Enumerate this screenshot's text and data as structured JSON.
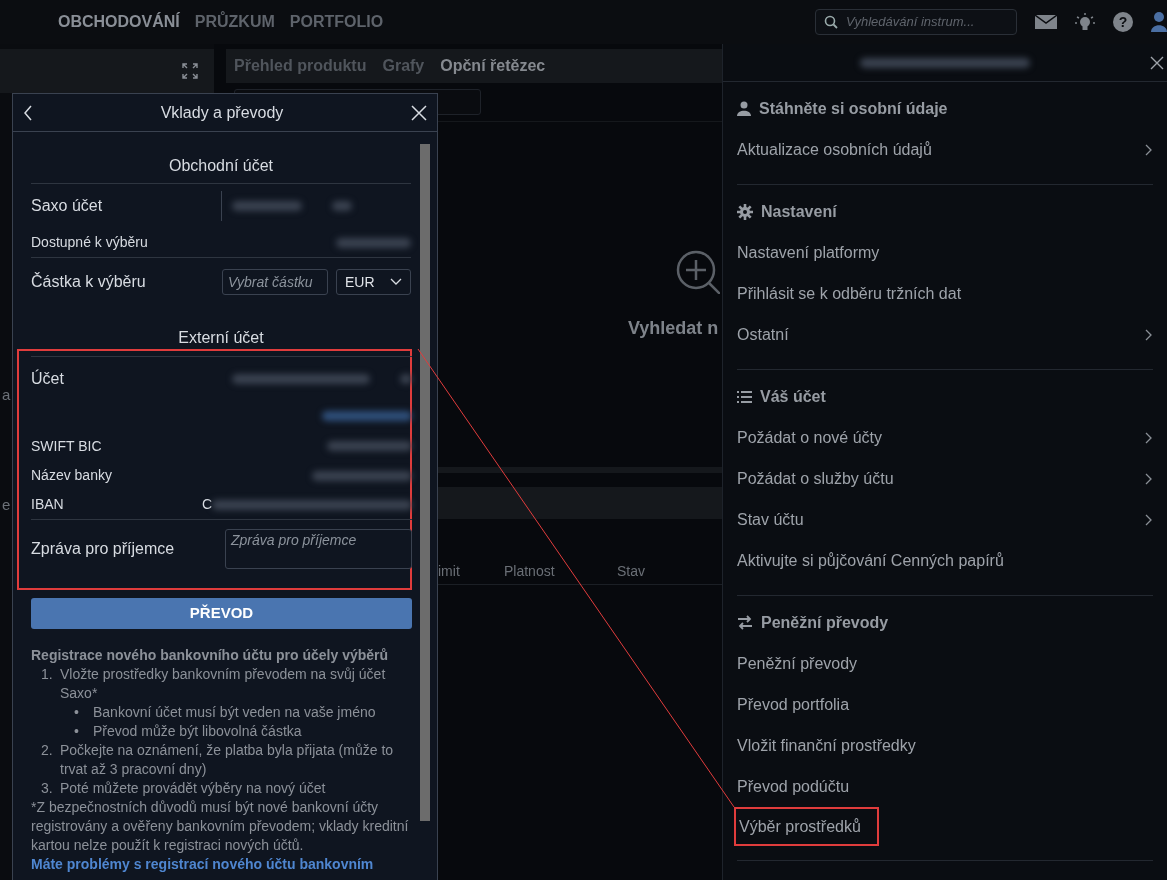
{
  "nav": {
    "tabs": [
      {
        "label": "OBCHODOVÁNÍ",
        "selected": true
      },
      {
        "label": "PRŮZKUM",
        "selected": false
      },
      {
        "label": "PORTFOLIO",
        "selected": false
      }
    ],
    "search": {
      "placeholder": "Vyhledávání instrum..."
    },
    "help_glyph": "?"
  },
  "left_panel": {
    "fragments": [
      "a",
      "e"
    ]
  },
  "product_panel": {
    "tabs": [
      {
        "label": "Přehled produktu",
        "selected": false
      },
      {
        "label": "Grafy",
        "selected": false
      },
      {
        "label": "Opční řetězec",
        "selected": true
      }
    ],
    "empty_text": "Vyhledat n"
  },
  "orders_table": {
    "columns": [
      "imit",
      "Platnost",
      "Stav"
    ]
  },
  "modal": {
    "title": "Vklady a převody",
    "trading_account": {
      "heading": "Obchodní účet",
      "account_label": "Saxo účet",
      "available_label": "Dostupné k výběru",
      "amount_label": "Částka k výběru",
      "amount_placeholder": "Vybrat částku",
      "currency": "EUR"
    },
    "external_account": {
      "heading": "Externí účet",
      "annotated": true,
      "account_label": "Účet",
      "swift_label": "SWIFT BIC",
      "bank_label": "Název banky",
      "iban_label": "IBAN",
      "iban_value": "C",
      "message_label": "Zpráva pro příjemce",
      "message_placeholder": "Zpráva pro příjemce"
    },
    "submit": "PŘEVOD",
    "info": {
      "heading": "Registrace nového bankovního účtu pro účely výběrů",
      "steps": [
        {
          "number": "1.",
          "text": "Vložte prostředky bankovním převodem na svůj účet Saxo*",
          "children": [
            {
              "bullet": "•",
              "text": "Bankovní účet musí být veden na vaše jméno"
            },
            {
              "bullet": "•",
              "text": "Převod může být libovolná částka"
            }
          ]
        },
        {
          "number": "2.",
          "text": "Počkejte na oznámení, že platba byla přijata (může to trvat až 3 pracovní dny)"
        },
        {
          "number": "3.",
          "text": "Poté můžete provádět výběry na nový účet"
        }
      ],
      "footnote": "*Z bezpečnostních důvodů musí být nové bankovní účty registrovány a ověřeny bankovním převodem; vklady kreditní kartou nelze použít k registraci nových účtů.",
      "link": "Máte problémy s registrací nového účtu bankovním"
    }
  },
  "drawer": {
    "sections": [
      {
        "heading": "Stáhněte si osobní údaje",
        "items": [
          {
            "label": "Aktualizace osobních údajů",
            "submenu": true,
            "annotated": false
          }
        ]
      },
      {
        "heading": "Nastavení",
        "items": [
          {
            "label": "Nastavení platformy",
            "submenu": false,
            "annotated": false
          },
          {
            "label": "Přihlásit se k odběru tržních dat",
            "submenu": false,
            "annotated": false
          },
          {
            "label": "Ostatní",
            "submenu": true,
            "annotated": false
          }
        ]
      },
      {
        "heading": "Váš účet",
        "items": [
          {
            "label": "Požádat o nové účty",
            "submenu": true,
            "annotated": false
          },
          {
            "label": "Požádat o služby účtu",
            "submenu": true,
            "annotated": false
          },
          {
            "label": "Stav účtu",
            "submenu": true,
            "annotated": false
          },
          {
            "label": "Aktivujte si půjčování Cenných papírů",
            "submenu": false,
            "annotated": false
          }
        ]
      },
      {
        "heading": "Peněžní převody",
        "items": [
          {
            "label": "Peněžní převody",
            "submenu": false,
            "annotated": false
          },
          {
            "label": "Převod portfolia",
            "submenu": false,
            "annotated": false
          },
          {
            "label": "Vložit finanční prostředky",
            "submenu": false,
            "annotated": false
          },
          {
            "label": "Převod podúčtu",
            "submenu": false,
            "annotated": false
          },
          {
            "label": "Výběr prostředků",
            "submenu": false,
            "annotated": true
          }
        ]
      }
    ]
  }
}
